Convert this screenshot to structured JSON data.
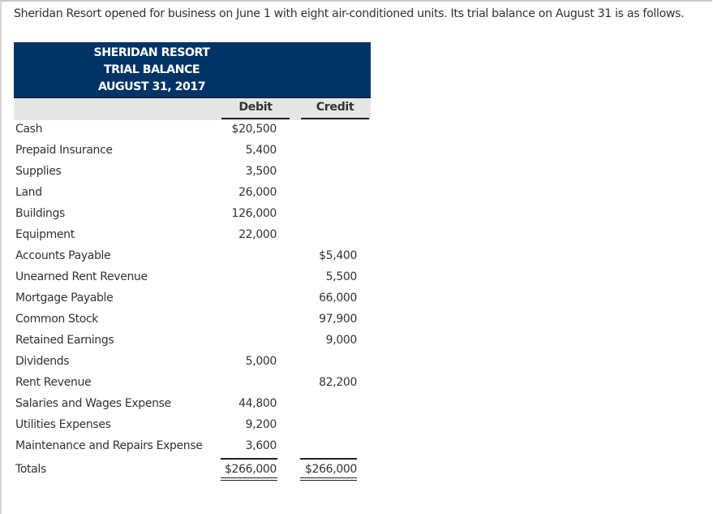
{
  "intro": "Sheridan Resort opened for business on June 1 with eight air-conditioned units. Its trial balance on August 31 is as follows.",
  "trial_balance": {
    "header": {
      "company": "SHERIDAN RESORT",
      "title": "TRIAL BALANCE",
      "date": "AUGUST 31, 2017"
    },
    "columns": {
      "debit": "Debit",
      "credit": "Credit"
    },
    "rows": [
      {
        "account": "Cash",
        "debit": "$20,500",
        "credit": ""
      },
      {
        "account": "Prepaid Insurance",
        "debit": "5,400",
        "credit": ""
      },
      {
        "account": "Supplies",
        "debit": "3,500",
        "credit": ""
      },
      {
        "account": "Land",
        "debit": "26,000",
        "credit": ""
      },
      {
        "account": "Buildings",
        "debit": "126,000",
        "credit": ""
      },
      {
        "account": "Equipment",
        "debit": "22,000",
        "credit": ""
      },
      {
        "account": "Accounts Payable",
        "debit": "",
        "credit": "$5,400"
      },
      {
        "account": "Unearned Rent Revenue",
        "debit": "",
        "credit": "5,500"
      },
      {
        "account": "Mortgage Payable",
        "debit": "",
        "credit": "66,000"
      },
      {
        "account": "Common Stock",
        "debit": "",
        "credit": "97,900"
      },
      {
        "account": "Retained Earnings",
        "debit": "",
        "credit": "9,000"
      },
      {
        "account": "Dividends",
        "debit": "5,000",
        "credit": ""
      },
      {
        "account": "Rent Revenue",
        "debit": "",
        "credit": "82,200"
      },
      {
        "account": "Salaries and Wages Expense",
        "debit": "44,800",
        "credit": ""
      },
      {
        "account": "Utilities Expenses",
        "debit": "9,200",
        "credit": ""
      },
      {
        "account": "Maintenance and Repairs Expense",
        "debit": "3,600",
        "credit": ""
      }
    ],
    "totals": {
      "label": "Totals",
      "debit": "$266,000",
      "credit": "$266,000"
    }
  }
}
